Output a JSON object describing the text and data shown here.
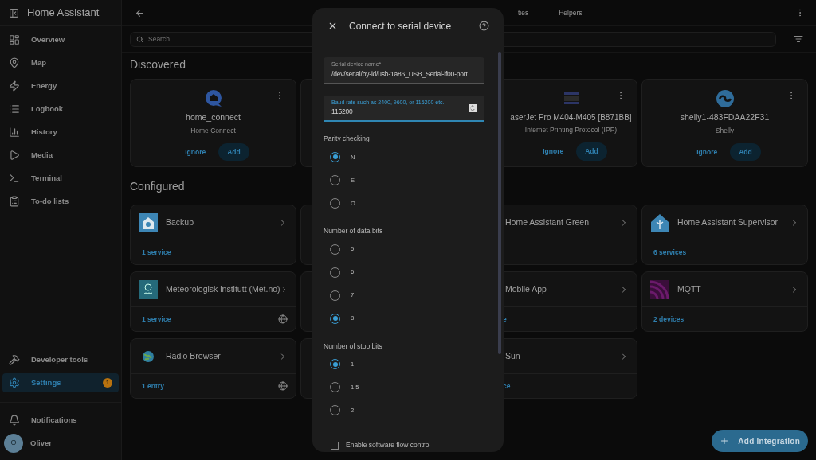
{
  "sidebar": {
    "title": "Home Assistant",
    "items": [
      {
        "label": "Overview",
        "selected": false
      },
      {
        "label": "Map",
        "selected": false
      },
      {
        "label": "Energy",
        "selected": false
      },
      {
        "label": "Logbook",
        "selected": false
      },
      {
        "label": "History",
        "selected": false
      },
      {
        "label": "Media",
        "selected": false
      },
      {
        "label": "Terminal",
        "selected": false
      },
      {
        "label": "To-do lists",
        "selected": false
      }
    ],
    "bottom_items": [
      {
        "label": "Developer tools",
        "selected": false
      },
      {
        "label": "Settings",
        "selected": true,
        "badge": "1"
      }
    ],
    "notifications": "Notifications",
    "user": {
      "name": "Oliver",
      "initial": "O"
    }
  },
  "topbar": {
    "tabs": [
      {
        "label": "ties",
        "selected": false
      },
      {
        "label": "Helpers",
        "selected": false
      }
    ]
  },
  "search": {
    "placeholder": "Search"
  },
  "discovered": {
    "heading": "Discovered",
    "cards": [
      {
        "kind": "full",
        "name": "home_connect",
        "integration": "Home Connect",
        "ignore": "Ignore",
        "add": "Add"
      },
      {
        "kind": "covered"
      },
      {
        "kind": "partial",
        "name": "aserJet Pro M404-M405 [B871BB]",
        "integration": "Internet Printing Protocol (IPP)",
        "ignore": "Ignore",
        "add": "Add"
      },
      {
        "kind": "full",
        "name": "shelly1-483FDAA22F31",
        "integration": "Shelly",
        "ignore": "Ignore",
        "add": "Add"
      }
    ]
  },
  "configured": {
    "heading": "Configured",
    "cards": [
      {
        "kind": "full",
        "name": "Backup",
        "footer": "1 service",
        "cloud": false
      },
      {
        "kind": "covered"
      },
      {
        "kind": "partial",
        "name": "Home Assistant Green",
        "cloud": false
      },
      {
        "kind": "full",
        "name": "Home Assistant Supervisor",
        "footer": "6 services",
        "cloud": false
      },
      {
        "kind": "full",
        "name": "Meteorologisk institutt (Met.no)",
        "footer": "1 service",
        "cloud": true
      },
      {
        "kind": "covered"
      },
      {
        "kind": "partial",
        "name": "Mobile App",
        "footer": "e",
        "cloud": false
      },
      {
        "kind": "full",
        "name": "MQTT",
        "footer": "2 devices",
        "cloud": false
      },
      {
        "kind": "full",
        "name": "Radio Browser",
        "footer": "1 entry",
        "cloud": true
      },
      {
        "kind": "covered"
      },
      {
        "kind": "partial",
        "name": "Sun",
        "footer": "ce",
        "cloud": false
      }
    ]
  },
  "fab": "Add integration",
  "dialog": {
    "title": "Connect to serial device",
    "fields": [
      {
        "kind": "text",
        "label": "Serial device name*",
        "value": "/dev/serial/by-id/usb-1a86_USB_Serial-if00-port",
        "focused": false
      },
      {
        "kind": "number",
        "label": "Baud rate such as 2400, 9600, or 115200 etc.",
        "value": "115200",
        "focused": true
      }
    ],
    "groups": [
      {
        "label": "Parity checking",
        "options": [
          {
            "label": "N",
            "selected": true
          },
          {
            "label": "E",
            "selected": false
          },
          {
            "label": "O",
            "selected": false
          }
        ]
      },
      {
        "label": "Number of data bits",
        "options": [
          {
            "label": "5",
            "selected": false
          },
          {
            "label": "6",
            "selected": false
          },
          {
            "label": "7",
            "selected": false
          },
          {
            "label": "8",
            "selected": true
          }
        ]
      },
      {
        "label": "Number of stop bits",
        "options": [
          {
            "label": "1",
            "selected": true
          },
          {
            "label": "1.5",
            "selected": false
          },
          {
            "label": "2",
            "selected": false
          }
        ]
      }
    ],
    "checkbox": {
      "label": "Enable software flow control",
      "checked": false
    }
  }
}
